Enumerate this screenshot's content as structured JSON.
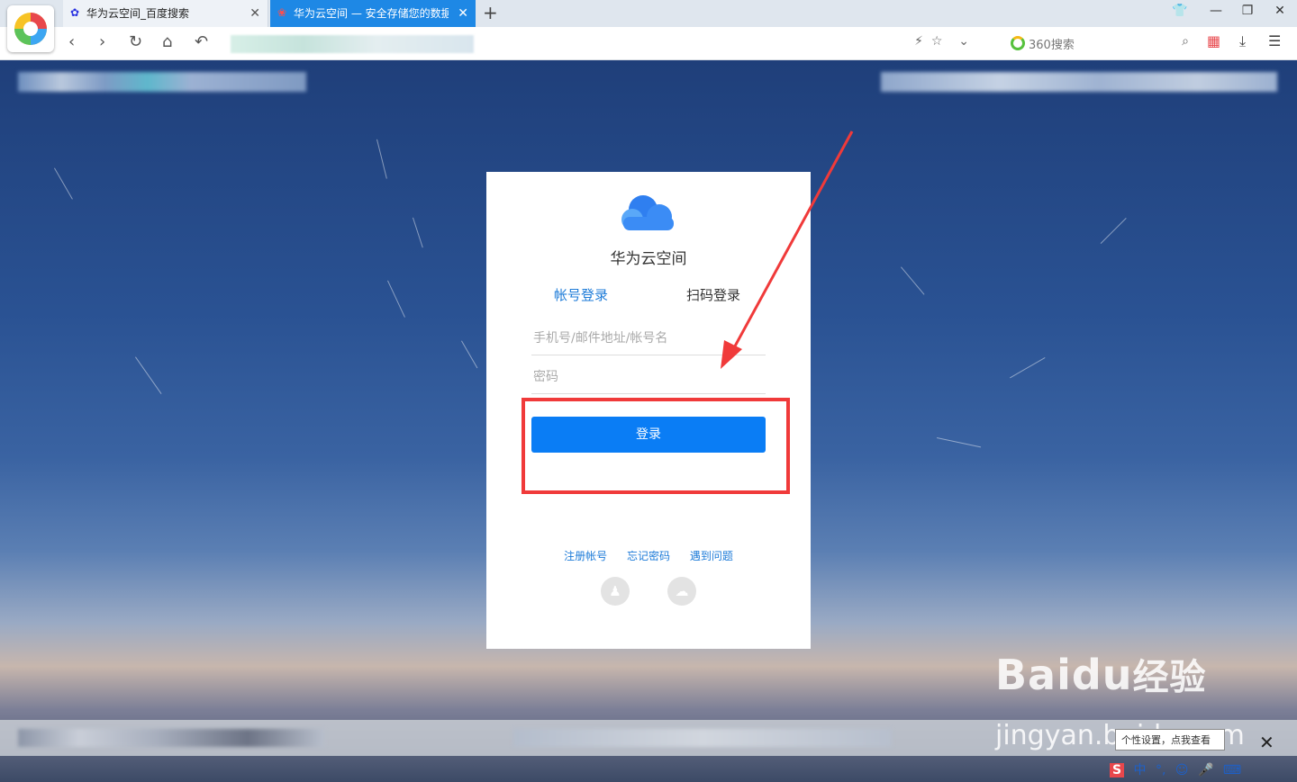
{
  "browser": {
    "tabs": [
      {
        "title": "华为云空间_百度搜索",
        "active": false
      },
      {
        "title": "华为云空间 — 安全存储您的数据",
        "active": true
      }
    ],
    "search_engine_label": "360搜索"
  },
  "login": {
    "title": "华为云空间",
    "tab_account": "帐号登录",
    "tab_qr": "扫码登录",
    "account_placeholder": "手机号/邮件地址/帐号名",
    "password_placeholder": "密码",
    "login_button": "登录",
    "links": [
      "注册帐号",
      "忘记密码",
      "遇到问题"
    ],
    "social_icons": [
      "qq-icon",
      "wechat-icon"
    ]
  },
  "watermark": {
    "main": "Bai",
    "du": "du",
    "cn": "经验",
    "sub": "jingyan.baidu.com"
  },
  "notification": {
    "text": "个性设置，点我查看"
  },
  "ime": {
    "label": "中"
  },
  "colors": {
    "accent": "#0a7df5",
    "link": "#1d7bd8",
    "annotation": "#f03a3a",
    "active_tab": "#1e88e5"
  }
}
